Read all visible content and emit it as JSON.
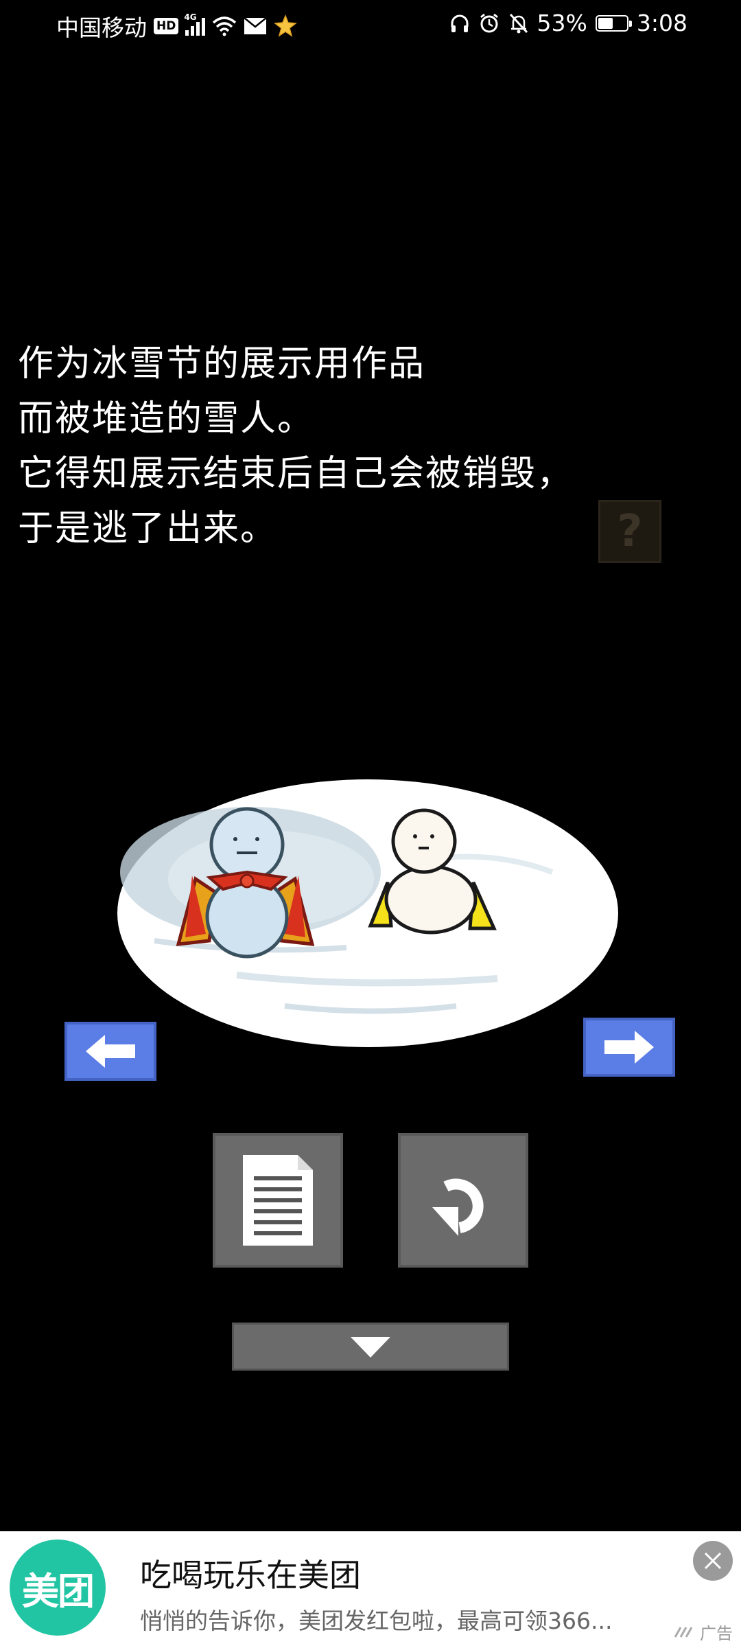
{
  "status_bar": {
    "carrier": "中国移动",
    "hd": "HD",
    "network": "4G",
    "battery_percent": "53%",
    "battery_level": 0.53,
    "time": "3:08"
  },
  "story": {
    "lines": [
      "作为冰雪节的展示用作品",
      "而被堆造的雪人。",
      "它得知展示结束后自己会被销毁，",
      "于是逃了出来。"
    ]
  },
  "hint_button": {
    "label": "?"
  },
  "nav": {
    "prev_icon": "arrow-left-icon",
    "next_icon": "arrow-right-icon"
  },
  "controls": {
    "doc_icon": "document-icon",
    "undo_icon": "undo-icon",
    "expand_icon": "chevron-down-icon"
  },
  "ad": {
    "logo_text": "美团",
    "title": "吃喝玩乐在美团",
    "subtitle": "悄悄的告诉你，美团发红包啦，最高可领366...",
    "tag": "广告"
  },
  "colors": {
    "arrow_blue": "#5b7de6",
    "button_gray": "#6b6b6b",
    "ad_logo_green": "#22c5a3"
  }
}
